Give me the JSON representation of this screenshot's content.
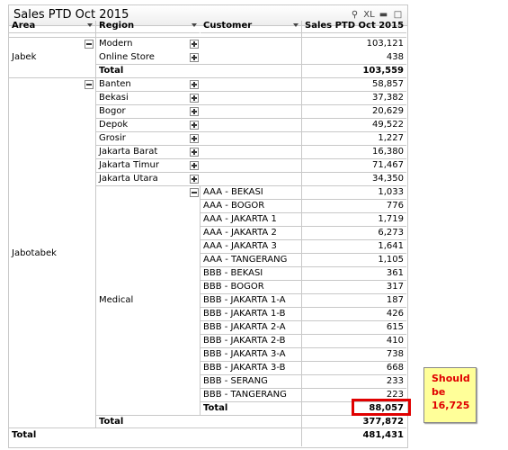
{
  "title": "Sales PTD Oct 2015",
  "caption_icons": {
    "export": "XL"
  },
  "headers": {
    "area": "Area",
    "region": "Region",
    "customer": "Customer",
    "sales": "Sales PTD Oct 2015"
  },
  "jabek": {
    "area": "Jabek",
    "rows": [
      {
        "region": "Modern",
        "value": "103,121"
      },
      {
        "region": "Online Store",
        "value": "438"
      }
    ],
    "total_label": "Total",
    "total_value": "103,559"
  },
  "jabotabek": {
    "area": "Jabotabek",
    "regions": [
      {
        "region": "Banten",
        "value": "58,857"
      },
      {
        "region": "Bekasi",
        "value": "37,382"
      },
      {
        "region": "Bogor",
        "value": "20,629"
      },
      {
        "region": "Depok",
        "value": "49,522"
      },
      {
        "region": "Grosir",
        "value": "1,227"
      },
      {
        "region": "Jakarta Barat",
        "value": "16,380"
      },
      {
        "region": "Jakarta Timur",
        "value": "71,467"
      },
      {
        "region": "Jakarta Utara",
        "value": "34,350"
      }
    ],
    "medical": {
      "region": "Medical",
      "customers": [
        {
          "name": "AAA - BEKASI",
          "value": "1,033"
        },
        {
          "name": "AAA - BOGOR",
          "value": "776"
        },
        {
          "name": "AAA - JAKARTA 1",
          "value": "1,719"
        },
        {
          "name": "AAA - JAKARTA 2",
          "value": "6,273"
        },
        {
          "name": "AAA - JAKARTA 3",
          "value": "1,641"
        },
        {
          "name": "AAA - TANGERANG",
          "value": "1,105"
        },
        {
          "name": "BBB - BEKASI",
          "value": "361"
        },
        {
          "name": "BBB - BOGOR",
          "value": "317"
        },
        {
          "name": "BBB - JAKARTA 1-A",
          "value": "187"
        },
        {
          "name": "BBB - JAKARTA 1-B",
          "value": "426"
        },
        {
          "name": "BBB - JAKARTA 2-A",
          "value": "615"
        },
        {
          "name": "BBB - JAKARTA 2-B",
          "value": "410"
        },
        {
          "name": "BBB - JAKARTA 3-A",
          "value": "738"
        },
        {
          "name": "BBB - JAKARTA 3-B",
          "value": "668"
        },
        {
          "name": "BBB - SERANG",
          "value": "233"
        },
        {
          "name": "BBB - TANGERANG",
          "value": "223"
        }
      ],
      "total_label": "Total",
      "total_value": "88,057"
    },
    "total_label": "Total",
    "total_value": "377,872"
  },
  "grand_total_label": "Total",
  "grand_total_value": "481,431",
  "annotation": "Should\nbe\n16,725"
}
